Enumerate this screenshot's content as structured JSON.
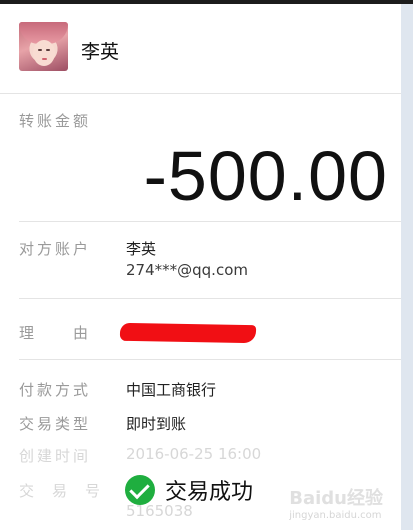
{
  "contact": {
    "name": "李英"
  },
  "transfer": {
    "amount_label": "转账金额",
    "amount": "-500.00"
  },
  "details": {
    "account_label": "对方账户",
    "account_name": "李英",
    "account_email": "274***@qq.com",
    "reason_label": "理　　由",
    "payment_method_label": "付款方式",
    "payment_method": "中国工商银行",
    "transaction_type_label": "交易类型",
    "transaction_type": "即时到账",
    "created_time_label": "创建时间",
    "created_time": "2016-06-25 16:00",
    "transaction_no_label": "交易号",
    "transaction_no_part": "5165038"
  },
  "status": {
    "text": "交易成功",
    "color": "#1fae3f"
  },
  "watermark": {
    "brand": "Baidu经验",
    "site": "jingyan.baidu.com"
  },
  "colors": {
    "redaction": "#f10f14"
  }
}
